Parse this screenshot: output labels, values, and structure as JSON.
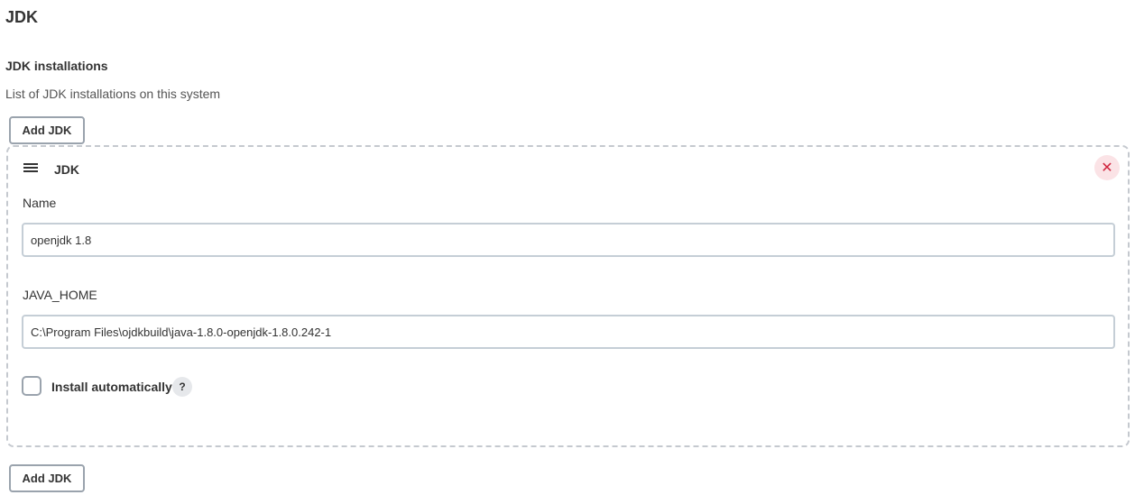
{
  "section": {
    "title": "JDK"
  },
  "jdk_installations": {
    "title": "JDK installations",
    "description": "List of JDK installations on this system",
    "add_button_label": "Add JDK",
    "items": [
      {
        "header": "JDK",
        "delete_icon": "close-icon",
        "name_label": "Name",
        "name_value": "openjdk 1.8",
        "java_home_label": "JAVA_HOME",
        "java_home_value": "C:\\Program Files\\ojdkbuild\\java-1.8.0-openjdk-1.8.0.242-1",
        "install_automatically_label": "Install automatically",
        "install_automatically_checked": false,
        "help_icon": "?"
      }
    ]
  },
  "colors": {
    "delete_bg": "#fbe3e6",
    "delete_fg": "#d0253e",
    "border": "#c5c9cf"
  }
}
